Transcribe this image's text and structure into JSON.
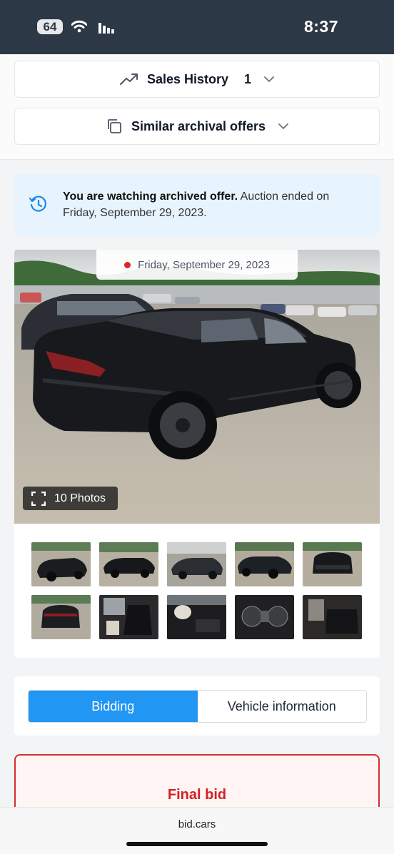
{
  "status_bar": {
    "battery": "64",
    "time": "8:37"
  },
  "sales_history": {
    "label": "Sales History",
    "count": "1"
  },
  "similar_offers": {
    "label": "Similar archival offers"
  },
  "notice": {
    "bold_text": "You are watching archived offer.",
    "text": " Auction ended on Friday, September 29, 2023."
  },
  "gallery": {
    "date": "Friday, September 29, 2023",
    "photos_label": "10 Photos",
    "thumbnails": [
      "rear-quarter",
      "side-lot",
      "side-wet",
      "front-quarter",
      "front",
      "rear",
      "interior-front",
      "dash-airbag",
      "gauges",
      "rear-seat"
    ]
  },
  "tabs": {
    "bidding": "Bidding",
    "vehicle_info": "Vehicle information"
  },
  "final_bid": {
    "label": "Final bid"
  },
  "browser": {
    "url": "bid.cars"
  },
  "colors": {
    "accent": "#2196f3",
    "alert": "#d42020",
    "status_bar": "#2c3846",
    "notice_bg": "#e7f3fd"
  }
}
